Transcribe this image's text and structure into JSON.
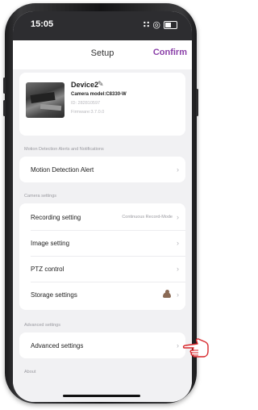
{
  "status": {
    "time": "15:05",
    "signal": "∷",
    "wifi": "◎"
  },
  "header": {
    "title": "Setup",
    "confirm_label": "Confirm"
  },
  "device": {
    "name": "Device2",
    "model": "Camera model:C8330-W",
    "id": "ID: 282810597",
    "firmware": "Firmware:3.7.0.0"
  },
  "sections": {
    "motion": {
      "label": "Motion Detection Alerts and Notifications",
      "items": [
        {
          "label": "Motion Detection Alert"
        }
      ]
    },
    "camera": {
      "label": "Camera settings",
      "items": [
        {
          "label": "Recording setting",
          "value": "Continuous Record-Mode"
        },
        {
          "label": "Image setting"
        },
        {
          "label": "PTZ control"
        },
        {
          "label": "Storage settings"
        }
      ]
    },
    "advanced": {
      "label": "Advanced settings",
      "items": [
        {
          "label": "Advanced settings"
        }
      ]
    },
    "about": {
      "label": "About"
    }
  },
  "icons": {
    "chevron": "›",
    "edit": "✎"
  },
  "colors": {
    "accent": "#8a3fa8",
    "hand": "#d7262a"
  }
}
